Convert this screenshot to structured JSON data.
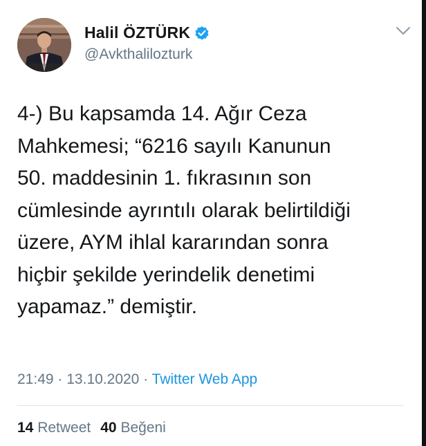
{
  "author": {
    "display_name": "Halil ÖZTÜRK",
    "handle": "@Avkthalilozturk",
    "verified": true,
    "verified_color": "#1da1f2"
  },
  "tweet": {
    "lines": [
      "4-) Bu kapsamda 14. Ağır Ceza",
      "Mahkemesi; “6216 sayılı Kanunun",
      "50. maddesinin 1. fıkrasının son",
      "cümlesinde ayrıntılı olarak belirtildiği",
      "üzere, AYM ihlal kararından sonra",
      "hiçbir şekilde yerindelik denetimi",
      "yapamaz.” demiştir."
    ]
  },
  "meta": {
    "time": "21:49",
    "date": "13.10.2020",
    "separator": "·",
    "source": "Twitter Web App",
    "source_color": "#1b95e0"
  },
  "stats": {
    "retweets_count": "14",
    "retweets_label": "Retweet",
    "likes_count": "40",
    "likes_label": "Beğeni"
  },
  "icons": {
    "menu": "chevron-down-icon",
    "verified": "verified-badge-icon"
  }
}
